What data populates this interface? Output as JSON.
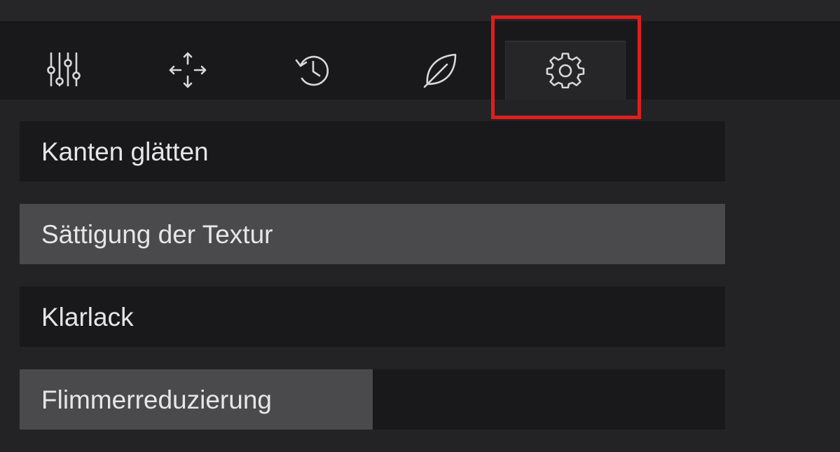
{
  "tabs": [
    {
      "name": "adjust",
      "icon": "sliders-icon"
    },
    {
      "name": "move",
      "icon": "move-arrows-icon"
    },
    {
      "name": "history",
      "icon": "history-icon"
    },
    {
      "name": "eco",
      "icon": "leaf-icon"
    },
    {
      "name": "settings",
      "icon": "gear-icon",
      "active": true
    }
  ],
  "settings": {
    "items": [
      {
        "label": "Kanten glätten",
        "level": 0
      },
      {
        "label": "Sättigung der Textur",
        "level": 1.0
      },
      {
        "label": "Klarlack",
        "level": 0
      },
      {
        "label": "Flimmerreduzierung",
        "level": 0.5
      }
    ]
  },
  "colors": {
    "background": "#232325",
    "tabbar": "#19191b",
    "row": "#19191b",
    "row_fill": "#4a4a4c",
    "text": "#e6e6e6",
    "highlight": "#e01e1e"
  }
}
